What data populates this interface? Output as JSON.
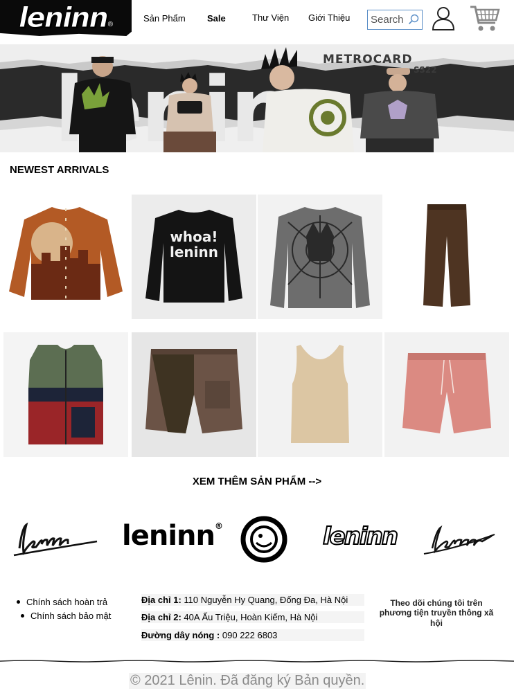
{
  "header": {
    "logo_text": "leninn",
    "logo_reg": "®",
    "nav": [
      "Sản Phẩm",
      "Sale",
      "Thư Viện",
      "Giới Thiệu"
    ],
    "search_placeholder": "Search"
  },
  "banner": {
    "big_word": "lenin",
    "title": "METROCARD",
    "subtitle": "SS22"
  },
  "newest": {
    "title": "NEWEST ARRIVALS",
    "products": [
      {
        "name": "rust-sunset-cardigan",
        "colors": [
          "#b35a25",
          "#6b2a14",
          "#d9b48a"
        ]
      },
      {
        "name": "whoa-leninn-sweater",
        "colors": [
          "#141414",
          "#f2f2f2"
        ]
      },
      {
        "name": "spiderweb-knit-sweater",
        "colors": [
          "#6d6d6d",
          "#2a2a2a"
        ]
      },
      {
        "name": "brown-wide-pants",
        "colors": [
          "#4e3422"
        ]
      },
      {
        "name": "colorblock-puffer-vest",
        "colors": [
          "#5c6e52",
          "#1d2438",
          "#9a2528"
        ]
      },
      {
        "name": "cargo-shorts",
        "colors": [
          "#6b5346",
          "#3e3322"
        ]
      },
      {
        "name": "beige-tank-top",
        "colors": [
          "#dcc6a3"
        ]
      },
      {
        "name": "pink-corduroy-shorts",
        "colors": [
          "#db8a82"
        ]
      }
    ],
    "more_label": "XEM THÊM SẢN PHẨM -->"
  },
  "brands": {
    "logo2_text": "leninn",
    "logo2_reg": "®",
    "logo4_text": "leninn"
  },
  "footer": {
    "policies": [
      "Chính sách hoàn trả",
      "Chính sách bảo mật"
    ],
    "address1_label": "Địa chỉ 1:",
    "address1": "110 Nguyễn Hy Quang, Đống Đa, Hà Nội",
    "address2_label": "Địa chỉ 2:",
    "address2": "40A Ấu Triệu, Hoàn Kiếm, Hà Nội",
    "hotline_label": "Đường dây nóng :",
    "hotline": "090 222 6803",
    "social_text": "Theo dõi chúng tôi trên phương tiện truyền thông xã hội",
    "copyright": "© 2021 Lênin. Đã đăng ký Bản quyền."
  }
}
